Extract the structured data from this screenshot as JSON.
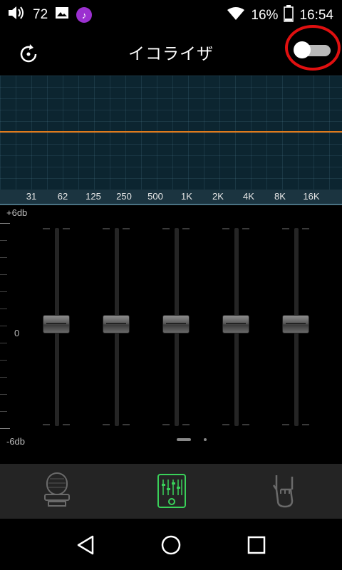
{
  "status_bar": {
    "volume_level": "72",
    "battery": "16%",
    "time": "16:54",
    "icons": [
      "volume-icon",
      "gallery-icon",
      "music-icon",
      "wifi-icon",
      "battery-icon"
    ]
  },
  "header": {
    "title": "イコライザ",
    "reset_icon": "reset-icon",
    "toggle_state": "off"
  },
  "graph": {
    "curve_color": "#e07a1a",
    "frequencies": [
      "31",
      "62",
      "125",
      "250",
      "500",
      "1K",
      "2K",
      "4K",
      "8K",
      "16K"
    ]
  },
  "sliders": {
    "max_label": "+6db",
    "mid_label": "0",
    "min_label": "-6db",
    "bands": [
      {
        "value": 0
      },
      {
        "value": 0
      },
      {
        "value": 0
      },
      {
        "value": 0
      },
      {
        "value": 0
      }
    ]
  },
  "pager": {
    "pages": 2,
    "current": 1
  },
  "tabs": [
    {
      "icon": "microphone-icon",
      "active": false
    },
    {
      "icon": "equalizer-icon",
      "active": true
    },
    {
      "icon": "rock-hand-icon",
      "active": false
    }
  ],
  "navbar": {
    "icons": [
      "back-icon",
      "home-icon",
      "recents-icon"
    ]
  },
  "colors": {
    "accent_green": "#3ad15a",
    "toggle_circle": "#e01010"
  }
}
